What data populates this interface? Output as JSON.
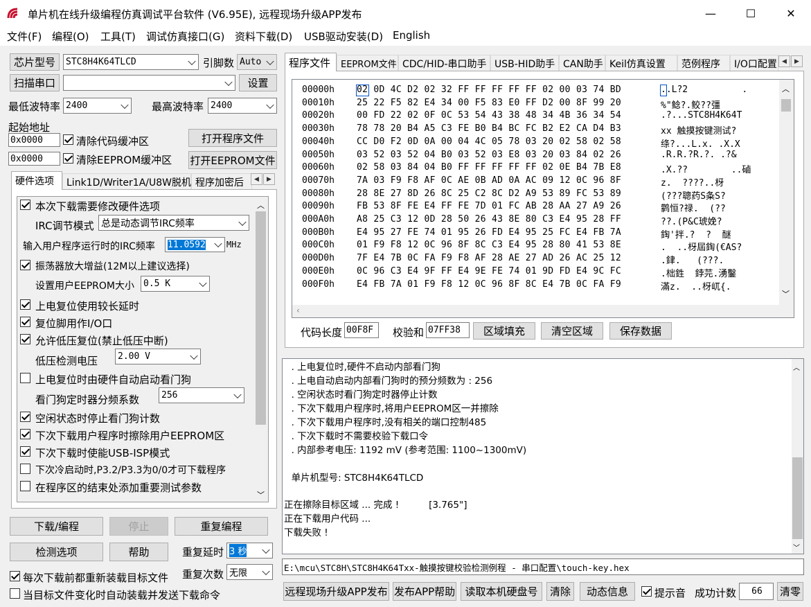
{
  "window": {
    "title": "单片机在线升级编程仿真调试平台软件 (V6.95E), 远程现场升级APP发布",
    "minimize": "—",
    "maximize": "☐",
    "close": "✕"
  },
  "menu": [
    "文件(F)",
    "编程(O)",
    "工具(T)",
    "调试仿真接口(G)",
    "资料下载(D)",
    "USB驱动安装(D)",
    "English"
  ],
  "left": {
    "chip_type_btn": "芯片型号",
    "chip_value": "STC8H4K64TLCD",
    "pins_label": "引脚数",
    "pins_value": "Auto",
    "scan_btn": "扫描串口",
    "port_value": "",
    "settings_btn": "设置",
    "min_baud_label": "最低波特率",
    "min_baud": "2400",
    "max_baud_label": "最高波特率",
    "max_baud": "2400",
    "start_addr_label": "起始地址",
    "addr1": "0x0000",
    "clear_code": "清除代码缓冲区",
    "open_prog_btn": "打开程序文件",
    "addr2": "0x0000",
    "clear_eeprom": "清除EEPROM缓冲区",
    "open_eeprom_btn": "打开EEPROM文件",
    "tabs": [
      "硬件选项",
      "Link1D/Writer1A/U8W脱机",
      "程序加密后"
    ],
    "hw": {
      "opt1": "本次下载需要修改硬件选项",
      "irc_mode_label": "IRC调节模式",
      "irc_mode": "总是动态调节IRC频率",
      "irc_freq_label": "输入用户程序运行时的IRC频率",
      "irc_freq": "11.0592",
      "mhz": "MHz",
      "opt2": "振荡器放大增益(12M以上建议选择)",
      "eeprom_size_label": "设置用户EEPROM大小",
      "eeprom_size": "0.5 K",
      "opt3": "上电复位使用较长延时",
      "opt4": "复位脚用作I/O口",
      "opt5": "允许低压复位(禁止低压中断)",
      "lvd_label": "低压检测电压",
      "lvd": "2.00 V",
      "opt6": "上电复位时由硬件自动启动看门狗",
      "wdt_label": "看门狗定时器分频系数",
      "wdt": "256",
      "opt7": "空闲状态时停止看门狗计数",
      "opt8": "下次下载用户程序时擦除用户EEPROM区",
      "opt9": "下次下载时使能USB-ISP模式",
      "opt10": "下次冷启动时,P3.2/P3.3为0/0才可下载程序",
      "opt11": "在程序区的结束处添加重要测试参数"
    },
    "download_btn": "下载/编程",
    "stop_btn": "停止",
    "reprog_btn": "重复编程",
    "detect_btn": "检测选项",
    "help_btn": "帮助",
    "repeat_delay_label": "重复延时",
    "repeat_delay": "3 秒",
    "reload_cb": "每次下载前都重新装载目标文件",
    "repeat_count_label": "重复次数",
    "repeat_count": "无限",
    "auto_cb": "当目标文件变化时自动装载并发送下载命令"
  },
  "right": {
    "tabs": [
      "程序文件",
      "EEPROM文件",
      "CDC/HID-串口助手",
      "USB-HID助手",
      "CAN助手",
      "Keil仿真设置",
      "范例程序",
      "I/O口配置"
    ],
    "hex_rows": [
      {
        "addr": "00000h",
        "bytes": "02 0D 4C D2 02 32 FF FF FF FF FF 02 00 03 74 BD",
        "ascii": "..L?2          ."
      },
      {
        "addr": "00010h",
        "bytes": "25 22 F5 82 E4 34 00 F5 83 E0 FF D2 00 8F 99 20",
        "ascii": "%\"鲶?.鲛??彊"
      },
      {
        "addr": "00020h",
        "bytes": "00 FD 22 02 0F 0C 53 54 43 38 48 34 4B 36 34 54",
        "ascii": ".?...STC8H4K64T"
      },
      {
        "addr": "00030h",
        "bytes": "78 78 20 B4 A5 C3 FE B0 B4 BC FC B2 E2 CA D4 B3",
        "ascii": "xx 触摸按键测试?"
      },
      {
        "addr": "00040h",
        "bytes": "CC D0 F2 0D 0A 00 04 4C 05 78 03 20 02 58 02 58",
        "ascii": "绦?...L.x. .X.X"
      },
      {
        "addr": "00050h",
        "bytes": "03 52 03 52 04 B0 03 52 03 E8 03 20 03 84 02 26",
        "ascii": ".R.R.?R.?. .?&"
      },
      {
        "addr": "00060h",
        "bytes": "02 58 03 84 04 B0 FF FF FF FF FF 02 0E B4 7B E8",
        "ascii": ".X.??        ..磠"
      },
      {
        "addr": "00070h",
        "bytes": "7A 03 F9 F8 AF 0C AE 0B AD 0A AC 09 12 0C 96 8F",
        "ascii": "z.  ????..枒"
      },
      {
        "addr": "00080h",
        "bytes": "28 8E 27 8D 26 8C 25 C2 8C D2 A9 53 89 FC 53 89",
        "ascii": "(???聰药S夈S?"
      },
      {
        "addr": "00090h",
        "bytes": "FB 53 8F FE E4 FF FE 7D 01 FC AB 28 AA 27 A9 26",
        "ascii": "鹲恒?禄.  (??"
      },
      {
        "addr": "000A0h",
        "bytes": "A8 25 C3 12 0D 28 50 26 43 8E 80 C3 E4 95 28 FF",
        "ascii": "??.(P&C琥娩?"
      },
      {
        "addr": "000B0h",
        "bytes": "E4 95 27 FE 74 01 95 26 FD E4 95 25 FC E4 FB 7A",
        "ascii": "鋾'拌.?  ?  醚"
      },
      {
        "addr": "000C0h",
        "bytes": "01 F9 F8 12 0C 96 8F 8C C3 E4 95 28 80 41 53 8E",
        "ascii": ".  ..枒屆鋾(€AS?"
      },
      {
        "addr": "000D0h",
        "bytes": "7F E4 7B 0C FA F9 F8 AF 28 AE 27 AD 26 AC 25 12",
        "ascii": ".銉.   (???."
      },
      {
        "addr": "000E0h",
        "bytes": "0C 96 C3 E4 9F FF E4 9E FE 74 01 9D FD E4 9C FC",
        "ascii": ".柮鉎  鋍芫.湧鑿"
      },
      {
        "addr": "000F0h",
        "bytes": "E4 FB 7A 01 F9 F8 12 0C 96 8F 8C E4 7B 0C FA F9",
        "ascii": "滿z.  ..枒屼{."
      }
    ],
    "code_len_label": "代码长度",
    "code_len": "00F8F",
    "checksum_label": "校验和",
    "checksum": "07FF38",
    "fill_btn": "区域填充",
    "clear_area_btn": "清空区域",
    "save_btn": "保存数据",
    "log": [
      "  . 上电复位时,硬件不启动内部看门狗",
      "  . 上电自动启动内部看门狗时的预分频数为 : 256",
      "  . 空闲状态时看门狗定时器停止计数",
      "  . 下次下载用户程序时,将用户EEPROM区一并擦除",
      "  . 下次下载用户程序时,没有相关的端口控制485",
      "  . 下次下载时不需要校验下载口令",
      "  . 内部参考电压: 1192 mV (参考范围: 1100~1300mV)",
      "",
      "  单片机型号: STC8H4K64TLCD",
      "",
      "正在擦除目标区域 ... 完成 !          [3.765\"]",
      "正在下载用户代码 ...",
      "下载失败 !"
    ],
    "file_path": "E:\\mcu\\STC8H\\STC8H4K64Txx-触摸按键校验检测例程 - 串口配置\\touch-key.hex",
    "remote_btn": "远程现场升级APP发布",
    "publish_help_btn": "发布APP帮助",
    "read_disk_btn": "读取本机硬盘号",
    "clear_btn": "清除",
    "dyn_info_btn": "动态信息",
    "beep_cb": "提示音",
    "success_label": "成功计数",
    "success_count": "66",
    "reset_btn": "清零"
  }
}
